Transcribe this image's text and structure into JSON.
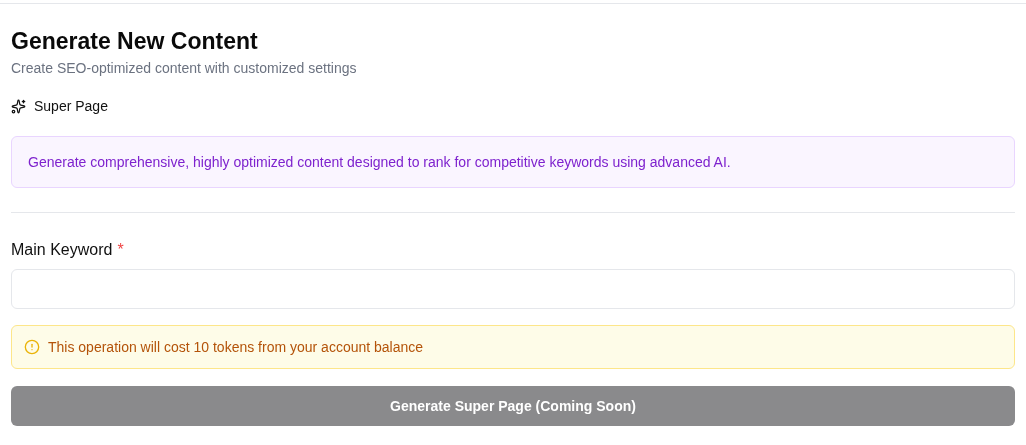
{
  "header": {
    "title": "Generate New Content",
    "subtitle": "Create SEO-optimized content with customized settings"
  },
  "mode": {
    "label": "Super Page"
  },
  "info": {
    "text": "Generate comprehensive, highly optimized content designed to rank for competitive keywords using advanced AI."
  },
  "keyword_field": {
    "label": "Main Keyword",
    "required_mark": "*"
  },
  "notice": {
    "text": "This operation will cost 10 tokens from your account balance"
  },
  "submit": {
    "label": "Generate Super Page (Coming Soon)",
    "disabled": true
  }
}
